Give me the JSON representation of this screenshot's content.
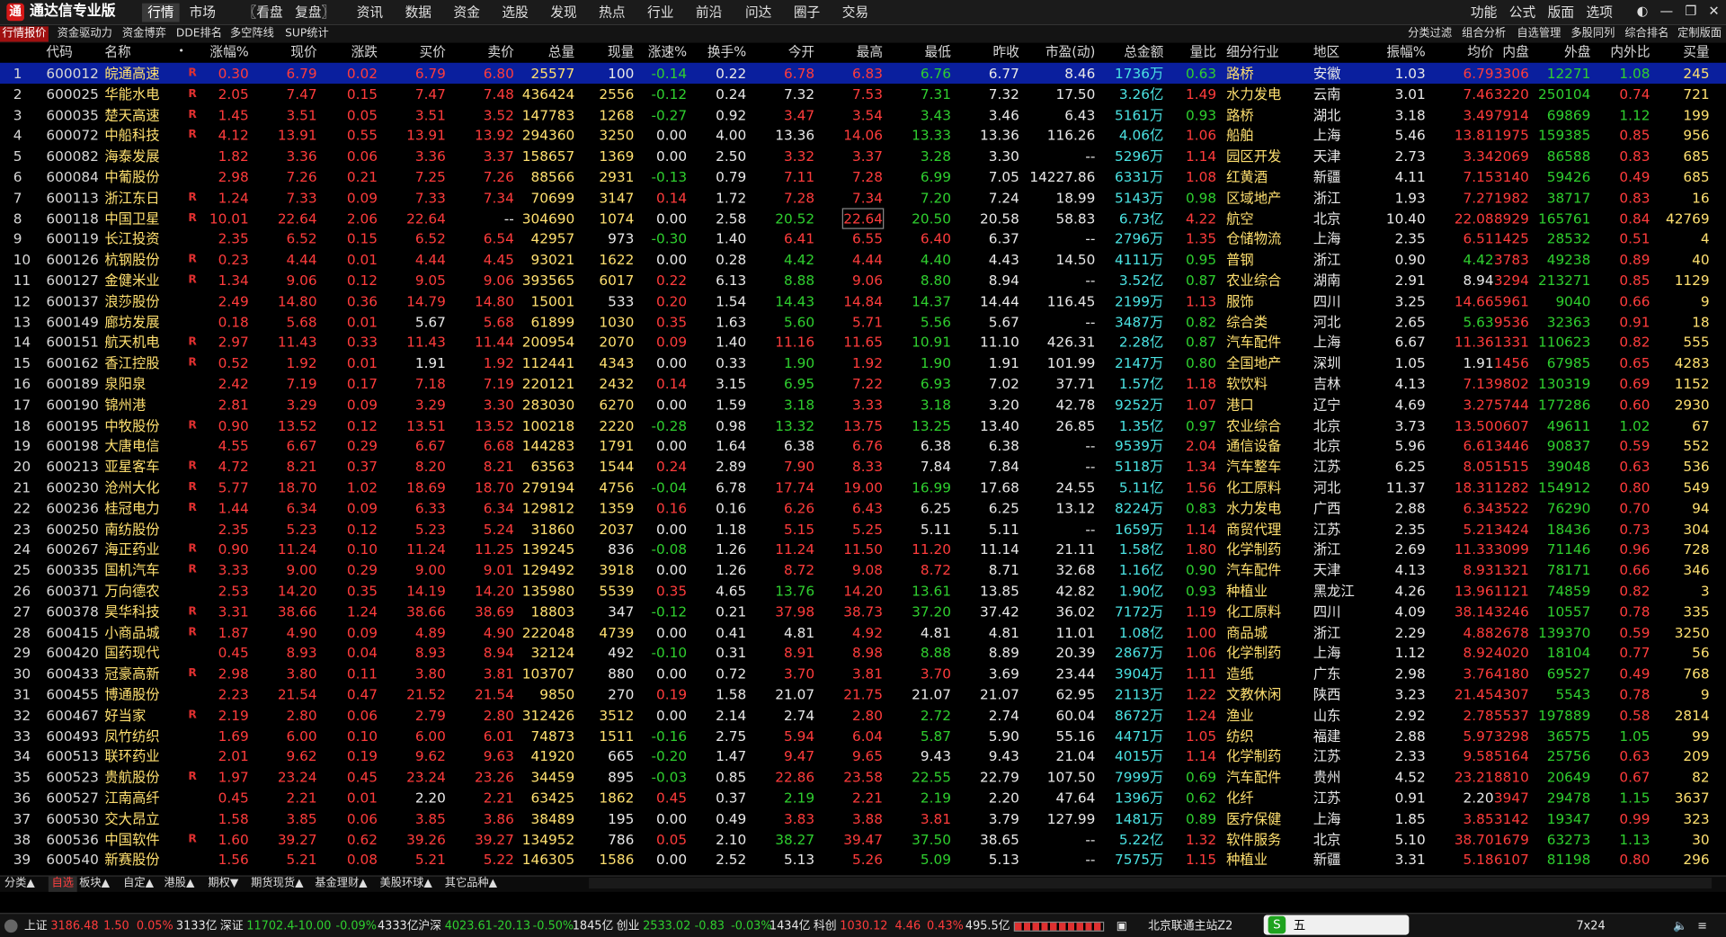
{
  "app": {
    "title": "通达信专业版"
  },
  "menu": [
    "行情",
    "市场",
    "〖看盘",
    "复盘〗",
    "资讯",
    "数据",
    "资金",
    "选股",
    "发现",
    "热点",
    "行业",
    "前沿",
    "问达",
    "圈子",
    "交易"
  ],
  "right_menu": [
    "功能",
    "公式",
    "版面",
    "选项"
  ],
  "toolbar_left": [
    "行情报价",
    "资金驱动力",
    "资金博弈",
    "DDE排名",
    "多空阵线",
    "SUP统计"
  ],
  "toolbar_right": [
    "分类过滤",
    "组合分析",
    "自选管理",
    "多股同列",
    "综合排名",
    "定制版面"
  ],
  "columns": [
    "代码",
    "名称",
    "涨幅%",
    "现价",
    "涨跌",
    "买价",
    "卖价",
    "总量",
    "现量",
    "涨速%",
    "换手%",
    "今开",
    "最高",
    "最低",
    "昨收",
    "市盈(动)",
    "总金额",
    "量比",
    "细分行业",
    "地区",
    "振幅%",
    "均价",
    "内盘",
    "外盘",
    "内外比",
    "买量"
  ],
  "rows": [
    [
      "1",
      "600012",
      "皖通高速",
      "R",
      "0.30",
      "6.79",
      "0.02",
      "6.79",
      "6.80",
      "25577",
      "100",
      "-0.14",
      "0.22",
      "6.78",
      "6.83",
      "6.76",
      "6.77",
      "8.46",
      "1736万",
      "0.63",
      "路桥",
      "安徽",
      "1.03",
      "6.79",
      "3306",
      "12271",
      "1.08",
      "245"
    ],
    [
      "2",
      "600025",
      "华能水电",
      "R",
      "2.05",
      "7.47",
      "0.15",
      "7.47",
      "7.48",
      "436424",
      "2556",
      "-0.12",
      "0.24",
      "7.32",
      "7.53",
      "7.31",
      "7.32",
      "17.50",
      "3.26亿",
      "1.49",
      "水力发电",
      "云南",
      "3.01",
      "7.46",
      "3220",
      "250104",
      "0.74",
      "721"
    ],
    [
      "3",
      "600035",
      "楚天高速",
      "R",
      "1.45",
      "3.51",
      "0.05",
      "3.51",
      "3.52",
      "147783",
      "1268",
      "-0.27",
      "0.92",
      "3.47",
      "3.54",
      "3.43",
      "3.46",
      "6.43",
      "5161万",
      "0.93",
      "路桥",
      "湖北",
      "3.18",
      "3.49",
      "7914",
      "69869",
      "1.12",
      "199"
    ],
    [
      "4",
      "600072",
      "中船科技",
      "R",
      "4.12",
      "13.91",
      "0.55",
      "13.91",
      "13.92",
      "294360",
      "3250",
      "0.00",
      "4.00",
      "13.36",
      "14.06",
      "13.33",
      "13.36",
      "116.26",
      "4.06亿",
      "1.06",
      "船舶",
      "上海",
      "5.46",
      "13.81",
      "1975",
      "159385",
      "0.85",
      "956"
    ],
    [
      "5",
      "600082",
      "海泰发展",
      "",
      "1.82",
      "3.36",
      "0.06",
      "3.36",
      "3.37",
      "158657",
      "1369",
      "0.00",
      "2.50",
      "3.32",
      "3.37",
      "3.28",
      "3.30",
      "--",
      "5296万",
      "1.14",
      "园区开发",
      "天津",
      "2.73",
      "3.34",
      "2069",
      "86588",
      "0.83",
      "685"
    ],
    [
      "6",
      "600084",
      "中葡股份",
      "",
      "2.98",
      "7.26",
      "0.21",
      "7.25",
      "7.26",
      "88566",
      "2931",
      "-0.13",
      "0.79",
      "7.11",
      "7.28",
      "6.99",
      "7.05",
      "14227.86",
      "6331万",
      "1.08",
      "红黄酒",
      "新疆",
      "4.11",
      "7.15",
      "3140",
      "59426",
      "0.49",
      "685"
    ],
    [
      "7",
      "600113",
      "浙江东日",
      "R",
      "1.24",
      "7.33",
      "0.09",
      "7.33",
      "7.34",
      "70699",
      "3147",
      "0.14",
      "1.72",
      "7.28",
      "7.34",
      "7.20",
      "7.24",
      "18.99",
      "5143万",
      "0.98",
      "区域地产",
      "浙江",
      "1.93",
      "7.27",
      "1982",
      "38717",
      "0.83",
      "16"
    ],
    [
      "8",
      "600118",
      "中国卫星",
      "R",
      "10.01",
      "22.64",
      "2.06",
      "22.64",
      "--",
      "304690",
      "1074",
      "0.00",
      "2.58",
      "20.52",
      "22.64",
      "20.50",
      "20.58",
      "58.83",
      "6.73亿",
      "4.22",
      "航空",
      "北京",
      "10.40",
      "22.08",
      "8929",
      "165761",
      "0.84",
      "42769"
    ],
    [
      "9",
      "600119",
      "长江投资",
      "",
      "2.35",
      "6.52",
      "0.15",
      "6.52",
      "6.54",
      "42957",
      "973",
      "-0.30",
      "1.40",
      "6.41",
      "6.55",
      "6.40",
      "6.37",
      "--",
      "2796万",
      "1.35",
      "仓储物流",
      "上海",
      "2.35",
      "6.51",
      "1425",
      "28532",
      "0.51",
      "4"
    ],
    [
      "10",
      "600126",
      "杭钢股份",
      "R",
      "0.23",
      "4.44",
      "0.01",
      "4.44",
      "4.45",
      "93021",
      "1622",
      "0.00",
      "0.28",
      "4.42",
      "4.44",
      "4.40",
      "4.43",
      "14.50",
      "4111万",
      "0.95",
      "普钢",
      "浙江",
      "0.90",
      "4.42",
      "3783",
      "49238",
      "0.89",
      "40"
    ],
    [
      "11",
      "600127",
      "金健米业",
      "R",
      "1.34",
      "9.06",
      "0.12",
      "9.05",
      "9.06",
      "393565",
      "6017",
      "0.22",
      "6.13",
      "8.88",
      "9.06",
      "8.80",
      "8.94",
      "--",
      "3.52亿",
      "0.87",
      "农业综合",
      "湖南",
      "2.91",
      "8.94",
      "3294",
      "213271",
      "0.85",
      "1129"
    ],
    [
      "12",
      "600137",
      "浪莎股份",
      "",
      "2.49",
      "14.80",
      "0.36",
      "14.79",
      "14.80",
      "15001",
      "533",
      "0.20",
      "1.54",
      "14.43",
      "14.84",
      "14.37",
      "14.44",
      "116.45",
      "2199万",
      "1.13",
      "服饰",
      "四川",
      "3.25",
      "14.66",
      "5961",
      "9040",
      "0.66",
      "9"
    ],
    [
      "13",
      "600149",
      "廊坊发展",
      "",
      "0.18",
      "5.68",
      "0.01",
      "5.67",
      "5.68",
      "61899",
      "1030",
      "0.35",
      "1.63",
      "5.60",
      "5.71",
      "5.56",
      "5.67",
      "--",
      "3487万",
      "0.82",
      "综合类",
      "河北",
      "2.65",
      "5.63",
      "9536",
      "32363",
      "0.91",
      "18"
    ],
    [
      "14",
      "600151",
      "航天机电",
      "R",
      "2.97",
      "11.43",
      "0.33",
      "11.43",
      "11.44",
      "200954",
      "2070",
      "0.09",
      "1.40",
      "11.16",
      "11.65",
      "10.91",
      "11.10",
      "426.31",
      "2.28亿",
      "0.87",
      "汽车配件",
      "上海",
      "6.67",
      "11.36",
      "1331",
      "110623",
      "0.82",
      "555"
    ],
    [
      "15",
      "600162",
      "香江控股",
      "R",
      "0.52",
      "1.92",
      "0.01",
      "1.91",
      "1.92",
      "112441",
      "4343",
      "0.00",
      "0.33",
      "1.90",
      "1.92",
      "1.90",
      "1.91",
      "101.99",
      "2147万",
      "0.80",
      "全国地产",
      "深圳",
      "1.05",
      "1.91",
      "1456",
      "67985",
      "0.65",
      "4283"
    ],
    [
      "16",
      "600189",
      "泉阳泉",
      "",
      "2.42",
      "7.19",
      "0.17",
      "7.18",
      "7.19",
      "220121",
      "2432",
      "0.14",
      "3.15",
      "6.95",
      "7.22",
      "6.93",
      "7.02",
      "37.71",
      "1.57亿",
      "1.18",
      "软饮料",
      "吉林",
      "4.13",
      "7.13",
      "9802",
      "130319",
      "0.69",
      "1152"
    ],
    [
      "17",
      "600190",
      "锦州港",
      "",
      "2.81",
      "3.29",
      "0.09",
      "3.29",
      "3.30",
      "283030",
      "6270",
      "0.00",
      "1.59",
      "3.18",
      "3.33",
      "3.18",
      "3.20",
      "42.78",
      "9252万",
      "1.07",
      "港口",
      "辽宁",
      "4.69",
      "3.27",
      "5744",
      "177286",
      "0.60",
      "2930"
    ],
    [
      "18",
      "600195",
      "中牧股份",
      "R",
      "0.90",
      "13.52",
      "0.12",
      "13.51",
      "13.52",
      "100218",
      "2220",
      "-0.28",
      "0.98",
      "13.32",
      "13.75",
      "13.25",
      "13.40",
      "26.85",
      "1.35亿",
      "0.97",
      "农业综合",
      "北京",
      "3.73",
      "13.50",
      "0607",
      "49611",
      "1.02",
      "67"
    ],
    [
      "19",
      "600198",
      "大唐电信",
      "",
      "4.55",
      "6.67",
      "0.29",
      "6.67",
      "6.68",
      "144283",
      "1791",
      "0.00",
      "1.64",
      "6.38",
      "6.76",
      "6.38",
      "6.38",
      "--",
      "9539万",
      "2.04",
      "通信设备",
      "北京",
      "5.96",
      "6.61",
      "3446",
      "90837",
      "0.59",
      "552"
    ],
    [
      "20",
      "600213",
      "亚星客车",
      "R",
      "4.72",
      "8.21",
      "0.37",
      "8.20",
      "8.21",
      "63563",
      "1544",
      "0.24",
      "2.89",
      "7.90",
      "8.33",
      "7.84",
      "7.84",
      "--",
      "5118万",
      "1.34",
      "汽车整车",
      "江苏",
      "6.25",
      "8.05",
      "1515",
      "39048",
      "0.63",
      "536"
    ],
    [
      "21",
      "600230",
      "沧州大化",
      "R",
      "5.77",
      "18.70",
      "1.02",
      "18.69",
      "18.70",
      "279194",
      "4756",
      "-0.04",
      "6.78",
      "17.74",
      "19.00",
      "16.99",
      "17.68",
      "24.55",
      "5.11亿",
      "1.56",
      "化工原料",
      "河北",
      "11.37",
      "18.31",
      "1282",
      "154912",
      "0.80",
      "549"
    ],
    [
      "22",
      "600236",
      "桂冠电力",
      "R",
      "1.44",
      "6.34",
      "0.09",
      "6.33",
      "6.34",
      "129812",
      "1359",
      "0.16",
      "0.16",
      "6.26",
      "6.43",
      "6.25",
      "6.25",
      "13.12",
      "8224万",
      "0.83",
      "水力发电",
      "广西",
      "2.88",
      "6.34",
      "3522",
      "76290",
      "0.70",
      "94"
    ],
    [
      "23",
      "600250",
      "南纺股份",
      "",
      "2.35",
      "5.23",
      "0.12",
      "5.23",
      "5.24",
      "31860",
      "2037",
      "0.00",
      "1.18",
      "5.15",
      "5.25",
      "5.11",
      "5.11",
      "--",
      "1659万",
      "1.14",
      "商贸代理",
      "江苏",
      "2.35",
      "5.21",
      "3424",
      "18436",
      "0.73",
      "304"
    ],
    [
      "24",
      "600267",
      "海正药业",
      "R",
      "0.90",
      "11.24",
      "0.10",
      "11.24",
      "11.25",
      "139245",
      "836",
      "-0.08",
      "1.26",
      "11.24",
      "11.50",
      "11.20",
      "11.14",
      "21.11",
      "1.58亿",
      "1.80",
      "化学制药",
      "浙江",
      "2.69",
      "11.33",
      "3099",
      "71146",
      "0.96",
      "728"
    ],
    [
      "25",
      "600335",
      "国机汽车",
      "R",
      "3.33",
      "9.00",
      "0.29",
      "9.00",
      "9.01",
      "129492",
      "3918",
      "0.00",
      "1.26",
      "8.72",
      "9.08",
      "8.72",
      "8.71",
      "32.68",
      "1.16亿",
      "0.90",
      "汽车配件",
      "天津",
      "4.13",
      "8.93",
      "1321",
      "78171",
      "0.66",
      "346"
    ],
    [
      "26",
      "600371",
      "万向德农",
      "",
      "2.53",
      "14.20",
      "0.35",
      "14.19",
      "14.20",
      "135980",
      "5539",
      "0.35",
      "4.65",
      "13.76",
      "14.20",
      "13.61",
      "13.85",
      "42.82",
      "1.90亿",
      "0.93",
      "种植业",
      "黑龙江",
      "4.26",
      "13.96",
      "1121",
      "74859",
      "0.82",
      "3"
    ],
    [
      "27",
      "600378",
      "昊华科技",
      "R",
      "3.31",
      "38.66",
      "1.24",
      "38.66",
      "38.69",
      "18803",
      "347",
      "-0.12",
      "0.21",
      "37.98",
      "38.73",
      "37.20",
      "37.42",
      "36.02",
      "7172万",
      "1.19",
      "化工原料",
      "四川",
      "4.09",
      "38.14",
      "3246",
      "10557",
      "0.78",
      "335"
    ],
    [
      "28",
      "600415",
      "小商品城",
      "R",
      "1.87",
      "4.90",
      "0.09",
      "4.89",
      "4.90",
      "222048",
      "4739",
      "0.00",
      "0.41",
      "4.81",
      "4.92",
      "4.81",
      "4.81",
      "11.01",
      "1.08亿",
      "1.00",
      "商品城",
      "浙江",
      "2.29",
      "4.88",
      "2678",
      "139370",
      "0.59",
      "3250"
    ],
    [
      "29",
      "600420",
      "国药现代",
      "",
      "0.45",
      "8.93",
      "0.04",
      "8.93",
      "8.94",
      "32124",
      "492",
      "-0.10",
      "0.31",
      "8.91",
      "8.98",
      "8.88",
      "8.89",
      "20.39",
      "2867万",
      "1.06",
      "化学制药",
      "上海",
      "1.12",
      "8.92",
      "4020",
      "18104",
      "0.77",
      "56"
    ],
    [
      "30",
      "600433",
      "冠豪高新",
      "R",
      "2.98",
      "3.80",
      "0.11",
      "3.80",
      "3.81",
      "103707",
      "880",
      "0.00",
      "0.72",
      "3.70",
      "3.81",
      "3.70",
      "3.69",
      "23.44",
      "3904万",
      "1.11",
      "造纸",
      "广东",
      "2.98",
      "3.76",
      "4180",
      "69527",
      "0.49",
      "768"
    ],
    [
      "31",
      "600455",
      "博通股份",
      "",
      "2.23",
      "21.54",
      "0.47",
      "21.52",
      "21.54",
      "9850",
      "270",
      "0.19",
      "1.58",
      "21.07",
      "21.75",
      "21.07",
      "21.07",
      "62.95",
      "2113万",
      "1.22",
      "文教休闲",
      "陕西",
      "3.23",
      "21.45",
      "4307",
      "5543",
      "0.78",
      "9"
    ],
    [
      "32",
      "600467",
      "好当家",
      "R",
      "2.19",
      "2.80",
      "0.06",
      "2.79",
      "2.80",
      "312426",
      "3512",
      "0.00",
      "2.14",
      "2.74",
      "2.80",
      "2.72",
      "2.74",
      "60.04",
      "8672万",
      "1.24",
      "渔业",
      "山东",
      "2.92",
      "2.78",
      "5537",
      "197889",
      "0.58",
      "2814"
    ],
    [
      "33",
      "600493",
      "凤竹纺织",
      "",
      "1.69",
      "6.00",
      "0.10",
      "6.00",
      "6.01",
      "74873",
      "1511",
      "-0.16",
      "2.75",
      "5.94",
      "6.04",
      "5.87",
      "5.90",
      "55.16",
      "4471万",
      "1.05",
      "纺织",
      "福建",
      "2.88",
      "5.97",
      "3298",
      "36575",
      "1.05",
      "99"
    ],
    [
      "34",
      "600513",
      "联环药业",
      "",
      "2.01",
      "9.62",
      "0.19",
      "9.62",
      "9.63",
      "41920",
      "665",
      "-0.20",
      "1.47",
      "9.47",
      "9.65",
      "9.43",
      "9.43",
      "21.04",
      "4015万",
      "1.14",
      "化学制药",
      "江苏",
      "2.33",
      "9.58",
      "5164",
      "25756",
      "0.63",
      "209"
    ],
    [
      "35",
      "600523",
      "贵航股份",
      "R",
      "1.97",
      "23.24",
      "0.45",
      "23.24",
      "23.26",
      "34459",
      "895",
      "-0.03",
      "0.85",
      "22.86",
      "23.58",
      "22.55",
      "22.79",
      "107.50",
      "7999万",
      "0.69",
      "汽车配件",
      "贵州",
      "4.52",
      "23.21",
      "8810",
      "20649",
      "0.67",
      "82"
    ],
    [
      "36",
      "600527",
      "江南高纤",
      "",
      "0.45",
      "2.21",
      "0.01",
      "2.20",
      "2.21",
      "63425",
      "1862",
      "0.45",
      "0.37",
      "2.19",
      "2.21",
      "2.19",
      "2.20",
      "47.64",
      "1396万",
      "0.62",
      "化纤",
      "江苏",
      "0.91",
      "2.20",
      "3947",
      "29478",
      "1.15",
      "3637"
    ],
    [
      "37",
      "600530",
      "交大昂立",
      "",
      "1.58",
      "3.85",
      "0.06",
      "3.85",
      "3.86",
      "38489",
      "195",
      "0.00",
      "0.49",
      "3.83",
      "3.88",
      "3.81",
      "3.79",
      "127.99",
      "1481万",
      "0.89",
      "医疗保健",
      "上海",
      "1.85",
      "3.85",
      "3142",
      "19347",
      "0.99",
      "323"
    ],
    [
      "38",
      "600536",
      "中国软件",
      "R",
      "1.60",
      "39.27",
      "0.62",
      "39.26",
      "39.27",
      "134952",
      "786",
      "0.05",
      "2.10",
      "38.27",
      "39.47",
      "37.50",
      "38.65",
      "--",
      "5.22亿",
      "1.32",
      "软件服务",
      "北京",
      "5.10",
      "38.70",
      "1679",
      "63273",
      "1.13",
      "30"
    ],
    [
      "39",
      "600540",
      "新赛股份",
      "",
      "1.56",
      "5.21",
      "0.08",
      "5.21",
      "5.22",
      "146305",
      "1586",
      "0.00",
      "2.52",
      "5.13",
      "5.26",
      "5.09",
      "5.13",
      "--",
      "7575万",
      "1.15",
      "种植业",
      "新疆",
      "3.31",
      "5.18",
      "6107",
      "81198",
      "0.80",
      "296"
    ]
  ],
  "bottom_tabs": [
    "分类▲",
    "自选",
    "板块▲",
    "自定▲",
    "港股▲",
    "期权▼",
    "期货现货▲",
    "基金理财▲",
    "美股环球▲",
    "其它品种▲"
  ],
  "status": {
    "sh_label": "上证",
    "sh_value": "3186.48",
    "sh_chg": "1.50",
    "sh_pct": "0.05%",
    "sh_amt": "3133亿",
    "sz_label": "深证",
    "sz_value": "11702.4",
    "sz_chg": "-10.00",
    "sz_pct": "-0.09%",
    "sz_amt": "4333亿",
    "hs_label": "沪深",
    "hs_value": "4023.61",
    "hs_chg": "-20.13",
    "hs_pct": "-0.50%",
    "hs_amt": "1845亿",
    "cy_label": "创业",
    "cy_value": "2533.02",
    "cy_chg": "-0.83",
    "cy_pct": "-0.03%",
    "cy_amt": "1434亿",
    "kc_label": "科创",
    "kc_value": "1030.12",
    "kc_chg": "4.46",
    "kc_pct": "0.43%",
    "kc_amt": "495.5亿",
    "server": "北京联通主站Z2",
    "ime": "五",
    "mode": "7x24"
  },
  "colors": {
    "up": "#ff3c3c",
    "down": "#2fcf2f",
    "name": "#ffe070",
    "amount": "#4be3e3",
    "selected_row": "#0a1f9e"
  }
}
